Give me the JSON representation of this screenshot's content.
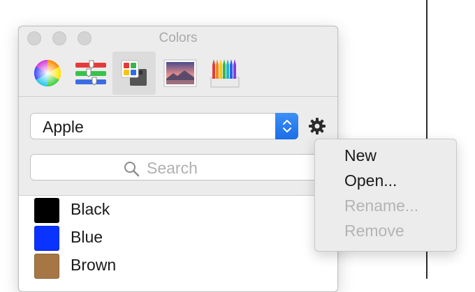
{
  "window": {
    "title": "Colors"
  },
  "toolbar": {
    "tabs": [
      {
        "name": "color-wheel",
        "icon": "color-wheel-icon"
      },
      {
        "name": "color-sliders",
        "icon": "color-sliders-icon"
      },
      {
        "name": "color-palettes",
        "icon": "color-palettes-icon",
        "selected": true
      },
      {
        "name": "image-palettes",
        "icon": "image-palettes-icon"
      },
      {
        "name": "pencils",
        "icon": "pencils-icon"
      }
    ]
  },
  "palette_select": {
    "value": "Apple"
  },
  "search": {
    "placeholder": "Search"
  },
  "colors": [
    {
      "name": "Black",
      "hex": "#000000"
    },
    {
      "name": "Blue",
      "hex": "#0b33ff"
    },
    {
      "name": "Brown",
      "hex": "#a67744"
    }
  ],
  "action_menu": {
    "items": [
      {
        "label": "New",
        "enabled": true
      },
      {
        "label": "Open...",
        "enabled": true
      },
      {
        "label": "Rename...",
        "enabled": false
      },
      {
        "label": "Remove",
        "enabled": false
      }
    ]
  },
  "accent": "#1b6ee6"
}
